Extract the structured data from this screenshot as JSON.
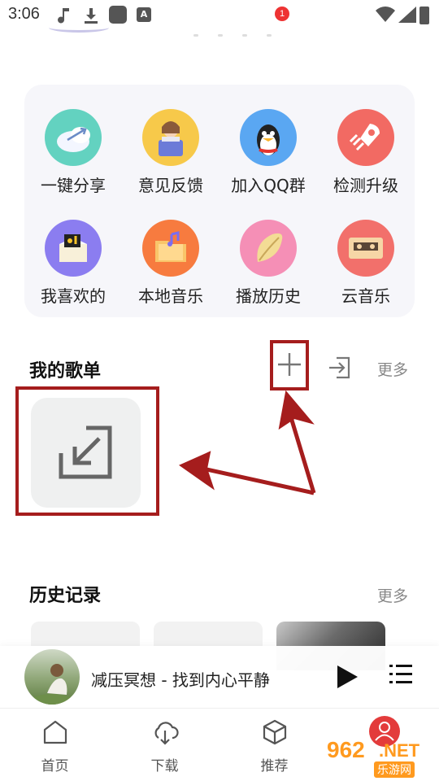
{
  "status_bar": {
    "time": "3:06",
    "badge_letter": "A"
  },
  "features": [
    {
      "label": "一键分享",
      "icon": "share-cloud-icon",
      "color": "#63d2c0"
    },
    {
      "label": "意见反馈",
      "icon": "feedback-person-icon",
      "color": "#f7c94a"
    },
    {
      "label": "加入QQ群",
      "icon": "qq-penguin-icon",
      "color": "#5aa7f2"
    },
    {
      "label": "检测升级",
      "icon": "rocket-icon",
      "color": "#f26a63"
    },
    {
      "label": "我喜欢的",
      "icon": "favorite-box-icon",
      "color": "#8b7df0"
    },
    {
      "label": "本地音乐",
      "icon": "local-folder-icon",
      "color": "#f77b3f"
    },
    {
      "label": "播放历史",
      "icon": "history-leaf-icon",
      "color": "#f58fb6"
    },
    {
      "label": "云音乐",
      "icon": "cassette-icon",
      "color": "#f2706b"
    }
  ],
  "playlist_section": {
    "title": "我的歌单",
    "more": "更多"
  },
  "history_section": {
    "title": "历史记录",
    "more": "更多"
  },
  "mini_player": {
    "track_title": "减压冥想 - 找到内心平静"
  },
  "bottom_nav": {
    "items": [
      {
        "label": "首页",
        "icon": "home-icon"
      },
      {
        "label": "下载",
        "icon": "cloud-download-icon"
      },
      {
        "label": "推荐",
        "icon": "cube-icon"
      },
      {
        "label": "",
        "icon": "profile-icon"
      }
    ],
    "badge_count": "1"
  },
  "watermark": {
    "brand": "962",
    "suffix": ".NET",
    "cn": "乐游网"
  },
  "colors": {
    "accent_red": "#e33b3b",
    "annotation_red": "#a51d1d"
  }
}
